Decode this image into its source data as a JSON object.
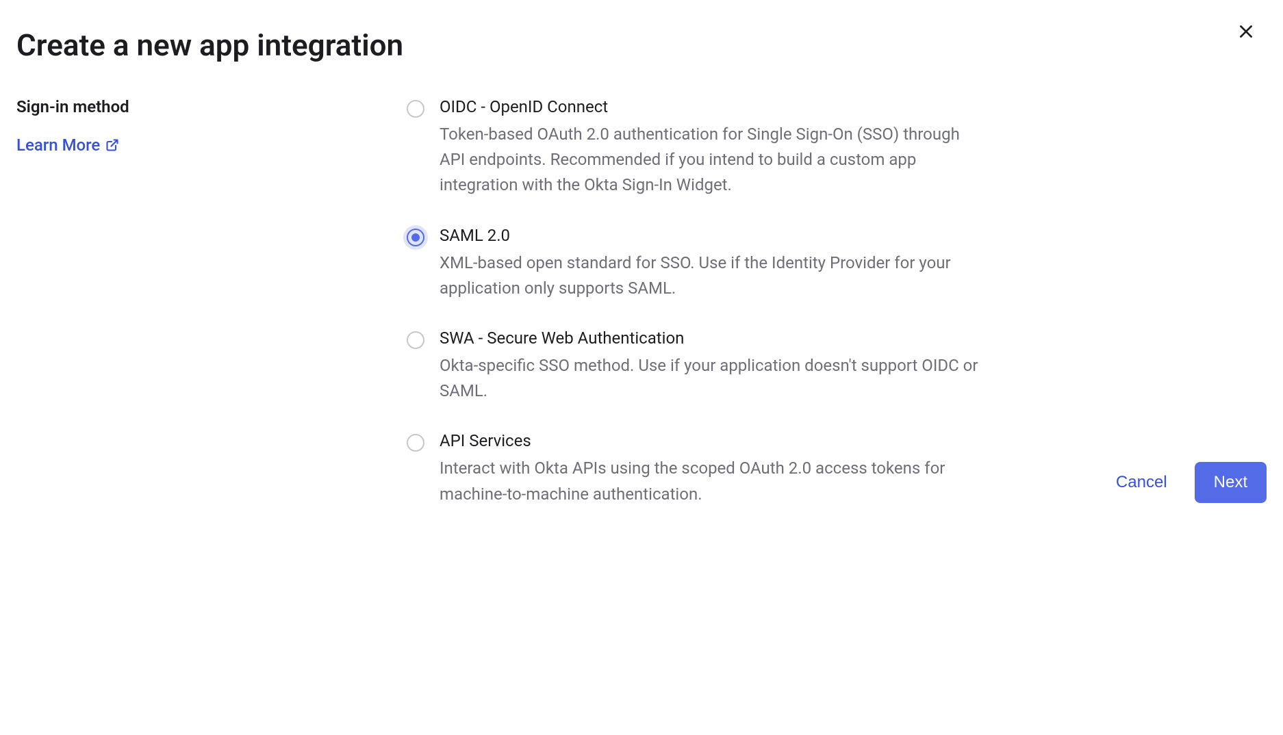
{
  "modal": {
    "title": "Create a new app integration",
    "close_label": "Close"
  },
  "section": {
    "heading": "Sign-in method",
    "learn_more": "Learn More"
  },
  "options": [
    {
      "id": "oidc",
      "title": "OIDC - OpenID Connect",
      "description": "Token-based OAuth 2.0 authentication for Single Sign-On (SSO) through API endpoints. Recommended if you intend to build a custom app integration with the Okta Sign-In Widget.",
      "selected": false
    },
    {
      "id": "saml",
      "title": "SAML 2.0",
      "description": "XML-based open standard for SSO. Use if the Identity Provider for your application only supports SAML.",
      "selected": true
    },
    {
      "id": "swa",
      "title": "SWA - Secure Web Authentication",
      "description": "Okta-specific SSO method. Use if your application doesn't support OIDC or SAML.",
      "selected": false
    },
    {
      "id": "api",
      "title": "API Services",
      "description": "Interact with Okta APIs using the scoped OAuth 2.0 access tokens for machine-to-machine authentication.",
      "selected": false
    }
  ],
  "footer": {
    "cancel": "Cancel",
    "next": "Next"
  },
  "colors": {
    "accent": "#546be8",
    "link": "#3651d4",
    "text_primary": "#1d1d21",
    "text_secondary": "#6e6e78",
    "radio_border": "#c7c7cc"
  }
}
